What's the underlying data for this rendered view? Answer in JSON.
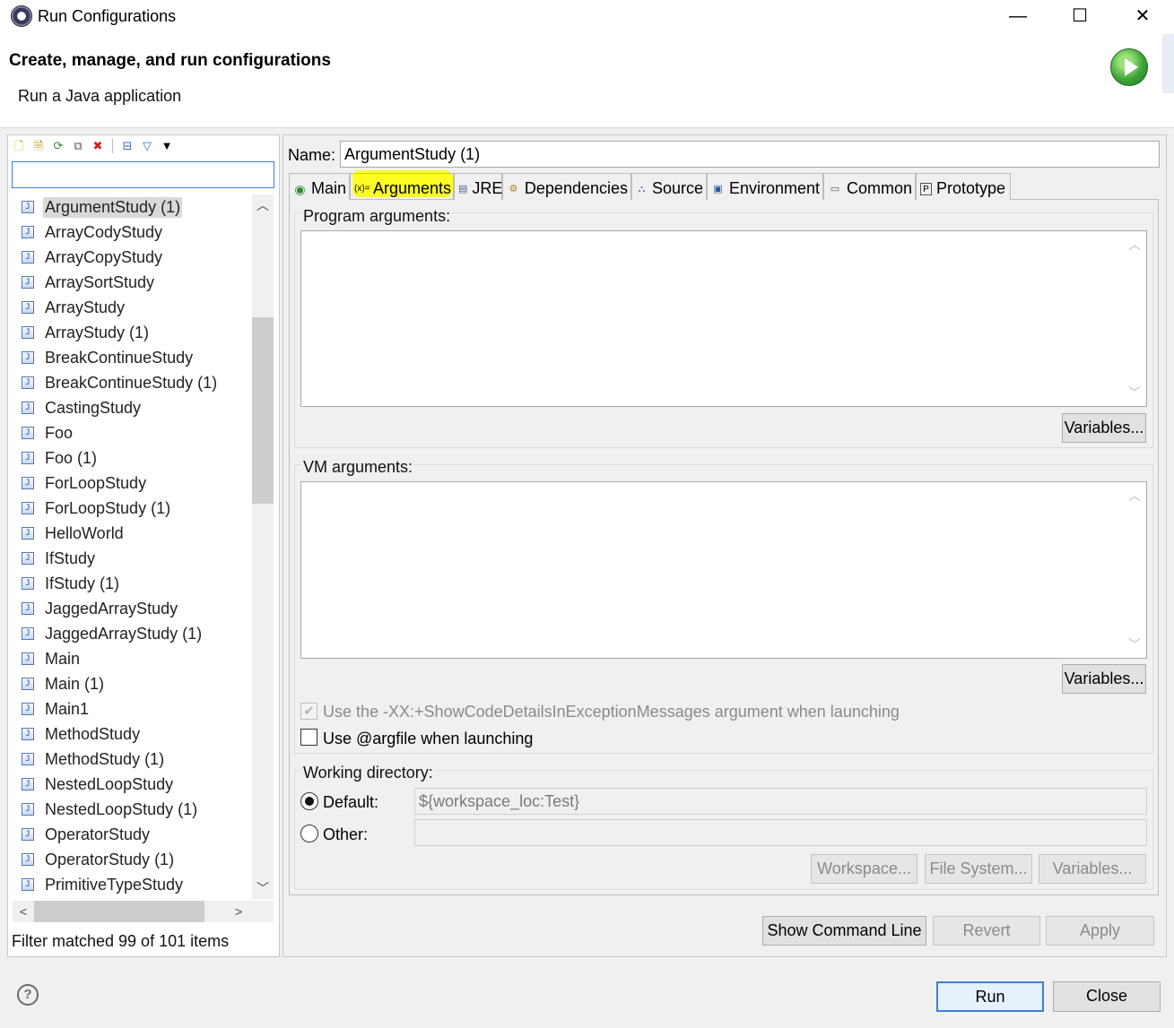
{
  "window": {
    "title": "Run Configurations",
    "minimize_glyph": "—",
    "maximize_glyph": "☐",
    "close_glyph": "✕"
  },
  "header": {
    "title": "Create, manage, and run configurations",
    "subtitle": "Run a Java application"
  },
  "left": {
    "filter_value": "",
    "items": [
      {
        "label": "ArgumentStudy (1)",
        "selected": true
      },
      {
        "label": "ArrayCodyStudy"
      },
      {
        "label": "ArrayCopyStudy"
      },
      {
        "label": "ArraySortStudy"
      },
      {
        "label": "ArrayStudy"
      },
      {
        "label": "ArrayStudy (1)"
      },
      {
        "label": "BreakContinueStudy"
      },
      {
        "label": "BreakContinueStudy (1)"
      },
      {
        "label": "CastingStudy"
      },
      {
        "label": "Foo"
      },
      {
        "label": "Foo (1)"
      },
      {
        "label": "ForLoopStudy"
      },
      {
        "label": "ForLoopStudy (1)"
      },
      {
        "label": "HelloWorld"
      },
      {
        "label": "IfStudy"
      },
      {
        "label": "IfStudy (1)"
      },
      {
        "label": "JaggedArrayStudy"
      },
      {
        "label": "JaggedArrayStudy (1)"
      },
      {
        "label": "Main"
      },
      {
        "label": "Main (1)"
      },
      {
        "label": "Main1"
      },
      {
        "label": "MethodStudy"
      },
      {
        "label": "MethodStudy (1)"
      },
      {
        "label": "NestedLoopStudy"
      },
      {
        "label": "NestedLoopStudy (1)"
      },
      {
        "label": "OperatorStudy"
      },
      {
        "label": "OperatorStudy (1)"
      },
      {
        "label": "PrimitiveTypeStudy"
      }
    ],
    "filter_status": "Filter matched 99 of 101 items"
  },
  "right": {
    "name_label": "Name:",
    "name_value": "ArgumentStudy (1)",
    "tabs": [
      {
        "label": "Main",
        "icon": "main-tab-icon"
      },
      {
        "label": "Arguments",
        "icon": "arguments-tab-icon",
        "active": true
      },
      {
        "label": "JRE",
        "icon": "jre-tab-icon"
      },
      {
        "label": "Dependencies",
        "icon": "dependencies-tab-icon"
      },
      {
        "label": "Source",
        "icon": "source-tab-icon"
      },
      {
        "label": "Environment",
        "icon": "environment-tab-icon"
      },
      {
        "label": "Common",
        "icon": "common-tab-icon"
      },
      {
        "label": "Prototype",
        "icon": "prototype-tab-icon"
      }
    ],
    "program_args": {
      "label": "Program arguments:",
      "value": "",
      "variables_button": "Variables..."
    },
    "vm_args": {
      "label": "VM arguments:",
      "value": "",
      "variables_button": "Variables..."
    },
    "show_code_details": {
      "label": "Use the -XX:+ShowCodeDetailsInExceptionMessages argument when launching",
      "checked": true,
      "disabled": true
    },
    "argfile": {
      "label": "Use @argfile when launching",
      "checked": false
    },
    "working_dir": {
      "label": "Working directory:",
      "default_label": "Default:",
      "default_value": "${workspace_loc:Test}",
      "other_label": "Other:",
      "other_value": "",
      "workspace_button": "Workspace...",
      "filesystem_button": "File System...",
      "variables_button": "Variables..."
    },
    "show_command_line": "Show Command Line",
    "revert": "Revert",
    "apply": "Apply"
  },
  "footer": {
    "help_glyph": "?",
    "run": "Run",
    "close": "Close"
  },
  "colors": {
    "highlight": "#ffff00",
    "focus_blue": "#3c7fd8",
    "run_green": "#3ea53a"
  }
}
